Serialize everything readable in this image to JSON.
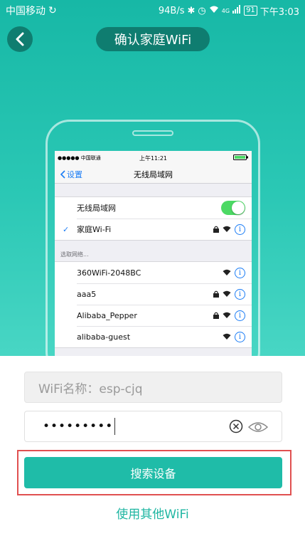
{
  "status_bar": {
    "carrier": "中国移动",
    "speed": "94B/s",
    "network": "4G",
    "battery": "91",
    "time": "下午3:03"
  },
  "header": {
    "title": "确认家庭WiFi"
  },
  "illustration": {
    "ios_status": {
      "carrier": "●●●●● 中国联通",
      "time": "上午11:21"
    },
    "nav": {
      "back_label": "设置",
      "title": "无线局域网"
    },
    "wlan_label": "无线局域网",
    "connected_network": "家庭Wi-Fi",
    "section_label": "选取网络...",
    "networks": [
      {
        "name": "360WiFi-2048BC",
        "locked": false
      },
      {
        "name": "aaa5",
        "locked": true
      },
      {
        "name": "Alibaba_Pepper",
        "locked": true
      },
      {
        "name": "alibaba-guest",
        "locked": false
      }
    ],
    "info_glyph": "i",
    "check_glyph": "✓"
  },
  "form": {
    "wifi_name_text": "WiFi名称：esp-cjq",
    "password_masked": "•••••••••",
    "search_button_label": "搜索设备",
    "other_wifi_link": "使用其他WiFi"
  },
  "colors": {
    "accent": "#1fbca8",
    "hero_top": "#17b8a6",
    "dark_pill": "#0f7d70",
    "highlight": "#e05050",
    "ios_blue": "#1a7cf5",
    "toggle_on": "#4cd964"
  }
}
